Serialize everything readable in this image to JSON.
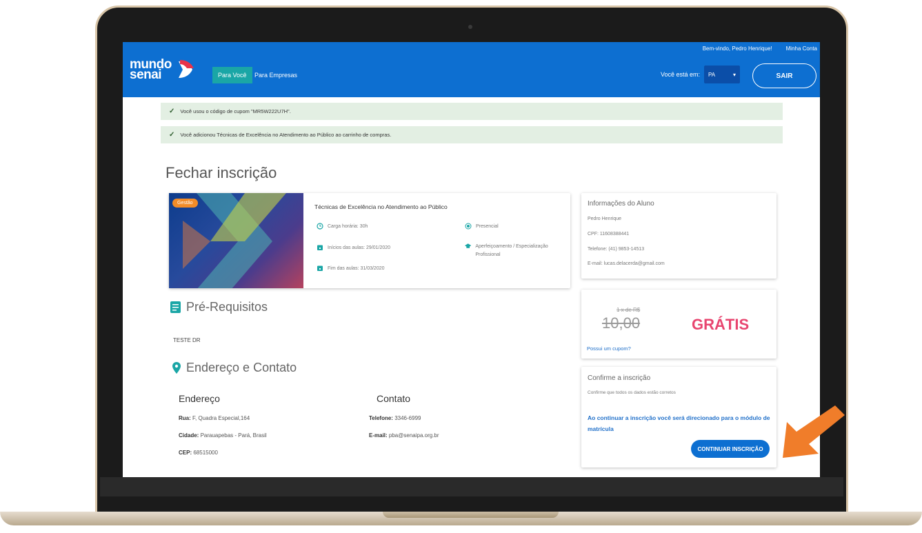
{
  "header": {
    "welcome_text": "Bem-vindo, Pedro Henrique!",
    "account_link": "Minha Conta",
    "logo_line1": "mundo",
    "logo_line2": "senai",
    "nav": [
      {
        "label": "Para Você",
        "active": true
      },
      {
        "label": "Para Empresas",
        "active": false
      }
    ],
    "location_label": "Você está em:",
    "location_value": "PA",
    "logout_label": "SAIR"
  },
  "alerts": [
    "Você usou o código de cupom \"MR5W222U7H\".",
    "Você adicionou Técnicas de Excelência no Atendimento ao Público ao carrinho de compras."
  ],
  "page_title": "Fechar inscrição",
  "course": {
    "category": "Gestão",
    "title": "Técnicas de Excelência no Atendimento ao Público",
    "workload": "Carga horária: 30h",
    "start": "Inícios das aulas: 29/01/2020",
    "end": "Fim das aulas: 31/03/2020",
    "mode": "Presencial",
    "type": "Aperfeiçoamento / Especialização Profissional"
  },
  "student": {
    "heading": "Informações do Aluno",
    "name": "Pedro Henrique",
    "cpf": "CPF: 11608388441",
    "phone": "Telefone: (41) 9853-14513",
    "email": "E-mail: lucas.delacerda@gmail.com"
  },
  "price": {
    "installments": "1 x de R$",
    "old_price": "10,00",
    "free_label": "GRÁTIS",
    "coupon_link": "Possui um cupom?"
  },
  "confirm": {
    "heading": "Confirme a inscrição",
    "subtext": "Confirme que todos os dados estão corretos",
    "notice": "Ao continuar a inscrição você será direcionado para o módulo de matrícula",
    "button": "CONTINUAR INSCRIÇÃO"
  },
  "prereq": {
    "heading": "Pré-Requisitos",
    "text": "TESTE DR"
  },
  "address": {
    "heading": "Endereço e Contato",
    "address_title": "Endereço",
    "street_label": "Rua:",
    "street": "F, Quadra Especial,164",
    "city_label": "Cidade:",
    "city": "Parauapebas - Pará, Brasil",
    "cep_label": "CEP:",
    "cep": "68515000",
    "contact_title": "Contato",
    "phone_label": "Telefone:",
    "phone": "3346-6999",
    "email_label": "E-mail:",
    "email": "pba@senaipa.org.br"
  },
  "colors": {
    "header_blue": "#0d6fd1",
    "teal": "#1aa6a6",
    "free_pink": "#e8456f",
    "arrow_orange": "#f07d2a"
  }
}
